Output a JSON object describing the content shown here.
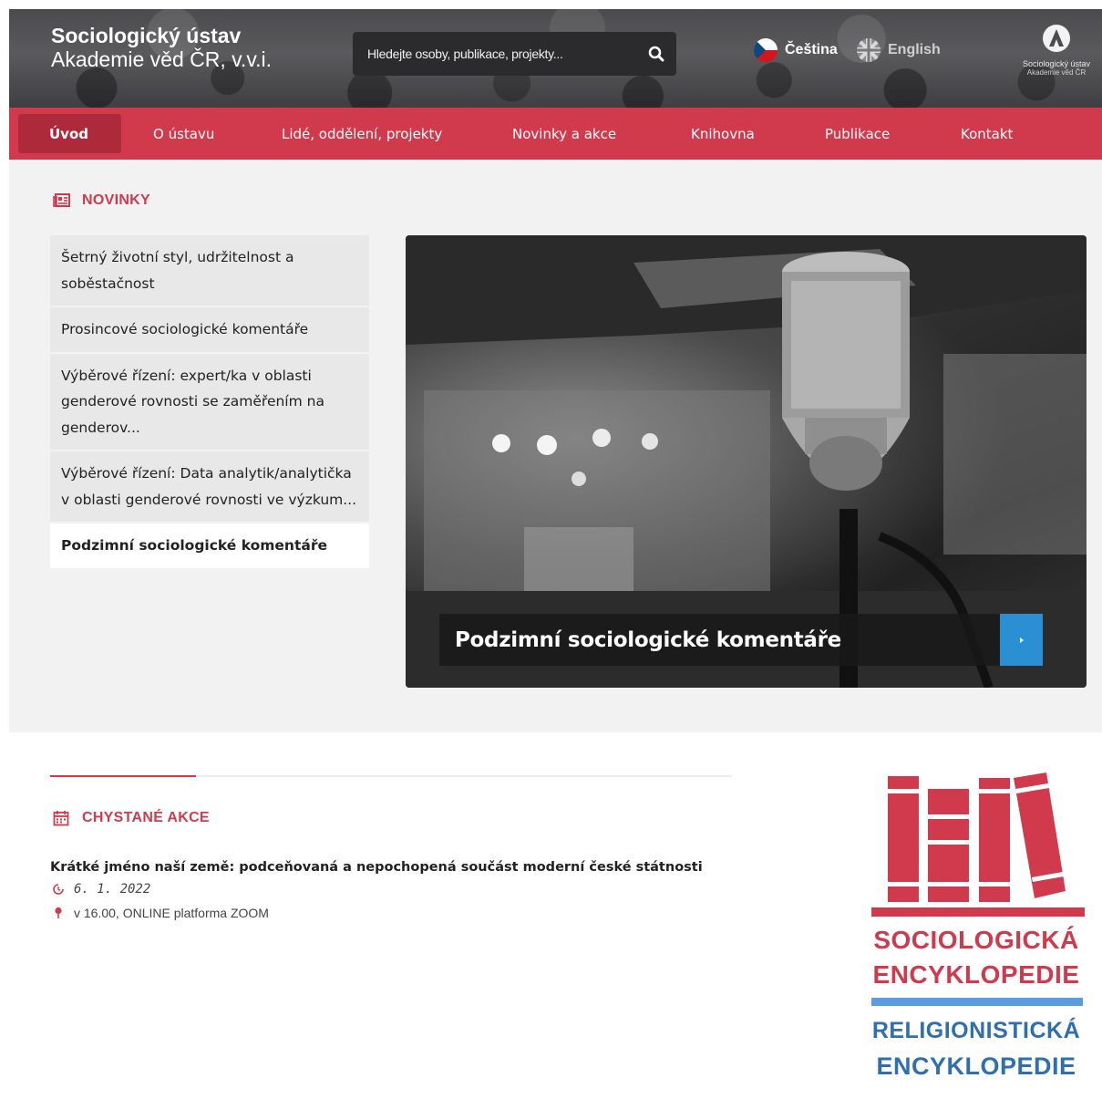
{
  "header": {
    "title_line1": "Sociologický ústav",
    "title_line2": "Akademie věd ČR, v.v.i.",
    "search_placeholder": "Hledejte osoby, publikace, projekty...",
    "languages": [
      {
        "label": "Čeština",
        "icon": "czech-flag-icon"
      },
      {
        "label": "English",
        "icon": "uk-flag-icon"
      }
    ],
    "institute_logo": {
      "line1": "Sociologický ústav",
      "line2": "Akademie věd ČR"
    }
  },
  "nav": {
    "items": [
      "Úvod",
      "O ústavu",
      "Lidé, oddělení, projekty",
      "Novinky a akce",
      "Knihovna",
      "Publikace",
      "Kontakt"
    ],
    "active": "Úvod"
  },
  "news": {
    "heading": "NOVINKY",
    "heading_icon": "newspaper-icon",
    "items": [
      "Šetrný životní styl, udržitelnost a soběstačnost",
      "Prosincové sociologické komentáře",
      "Výběrové řízení: expert/ka v oblasti genderové rovnosti se zaměřením na genderov...",
      "Výběrové řízení: Data analytik/analytička v oblasti genderové rovnosti ve výzkum...",
      "Podzimní sociologické komentáře"
    ],
    "selected": "Podzimní sociologické komentáře",
    "feature_caption": "Podzimní sociologické komentáře"
  },
  "events": {
    "heading": "CHYSTANÉ AKCE",
    "heading_icon": "calendar-icon",
    "items": [
      {
        "title": "Krátké jméno naší země: podceňovaná a nepochopená součást moderní české státnosti",
        "date": "6. 1. 2022",
        "place": "v 16.00, ONLINE platforma ZOOM"
      }
    ]
  },
  "encyclopedia": {
    "line1": "SOCIOLOGICKÁ",
    "line2": "ENCYKLOPEDIE",
    "line3": "RELIGIONISTICKÁ",
    "line4": "ENCYKLOPEDIE"
  },
  "colors": {
    "accent_red": "#d03a4c",
    "nav_active": "#ad2a3a",
    "blue": "#2b8fd3",
    "ency_blue": "#2f6fb0"
  }
}
